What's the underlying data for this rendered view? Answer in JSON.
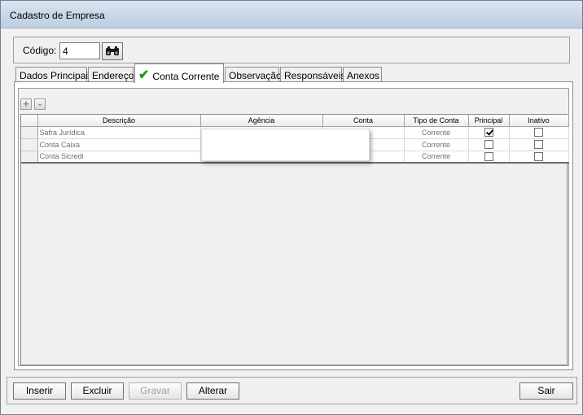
{
  "window": {
    "title": "Cadastro de Empresa"
  },
  "code": {
    "label": "Código:",
    "value": "4",
    "search_icon": "binoculars-icon"
  },
  "tabs": [
    {
      "label": "Dados Principais"
    },
    {
      "label": "Endereço"
    },
    {
      "label": "Conta Corrente",
      "active": true,
      "icon": "check-icon"
    },
    {
      "label": "Observação"
    },
    {
      "label": "Responsáveis"
    },
    {
      "label": "Anexos"
    }
  ],
  "grid_toolbar": {
    "add": "+",
    "remove": "-"
  },
  "grid": {
    "headers": {
      "descricao": "Descrição",
      "agencia": "Agência",
      "conta": "Conta",
      "tipo": "Tipo de Conta",
      "principal": "Principal",
      "inativo": "Inativo"
    },
    "rows": [
      {
        "descricao": "Safra Jurídica",
        "agencia": "",
        "conta": "",
        "tipo": "Corrente",
        "principal": true,
        "inativo": false
      },
      {
        "descricao": "Conta Caixa",
        "agencia": "",
        "conta": "",
        "tipo": "Corrente",
        "principal": false,
        "inativo": false
      },
      {
        "descricao": "Conta Sicredi",
        "agencia": "",
        "conta": "",
        "tipo": "Corrente",
        "principal": false,
        "inativo": false
      }
    ]
  },
  "footer": {
    "inserir": "Inserir",
    "excluir": "Excluir",
    "gravar": "Gravar",
    "alterar": "Alterar",
    "sair": "Sair"
  },
  "colors": {
    "active_check": "#1e9a1e",
    "titlebar": "#c9d6e6"
  }
}
